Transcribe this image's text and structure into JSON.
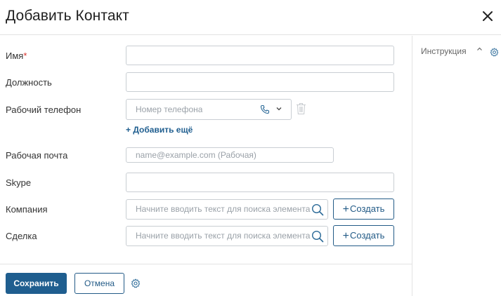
{
  "dialog": {
    "title": "Добавить Контакт",
    "close_icon": "close-icon"
  },
  "form": {
    "name": {
      "label": "Имя",
      "required_mark": "*",
      "value": ""
    },
    "position": {
      "label": "Должность",
      "value": ""
    },
    "work_phone": {
      "label": "Рабочий телефон",
      "placeholder": "Номер телефона",
      "type_icon": "phone-icon",
      "add_more_label": "+ Добавить ещё"
    },
    "work_email": {
      "label": "Рабочая почта",
      "placeholder": "name@example.com (Рабочая)"
    },
    "skype": {
      "label": "Skype",
      "value": ""
    },
    "company": {
      "label": "Компания",
      "placeholder": "Начните вводить текст для поиска элемента",
      "create_label": "Создать"
    },
    "deal": {
      "label": "Сделка",
      "placeholder": "Начните вводить текст для поиска элемента",
      "create_label": "Создать"
    }
  },
  "footer": {
    "save_label": "Сохранить",
    "cancel_label": "Отмена",
    "settings_icon": "gear-icon"
  },
  "sidebar": {
    "title": "Инструкция",
    "caret_icon": "chevron-up-icon",
    "settings_icon": "gear-icon"
  },
  "colors": {
    "accent": "#1f5e8f",
    "required": "#d9312b",
    "border": "#c9ced3",
    "divider": "#e3e3e3"
  }
}
